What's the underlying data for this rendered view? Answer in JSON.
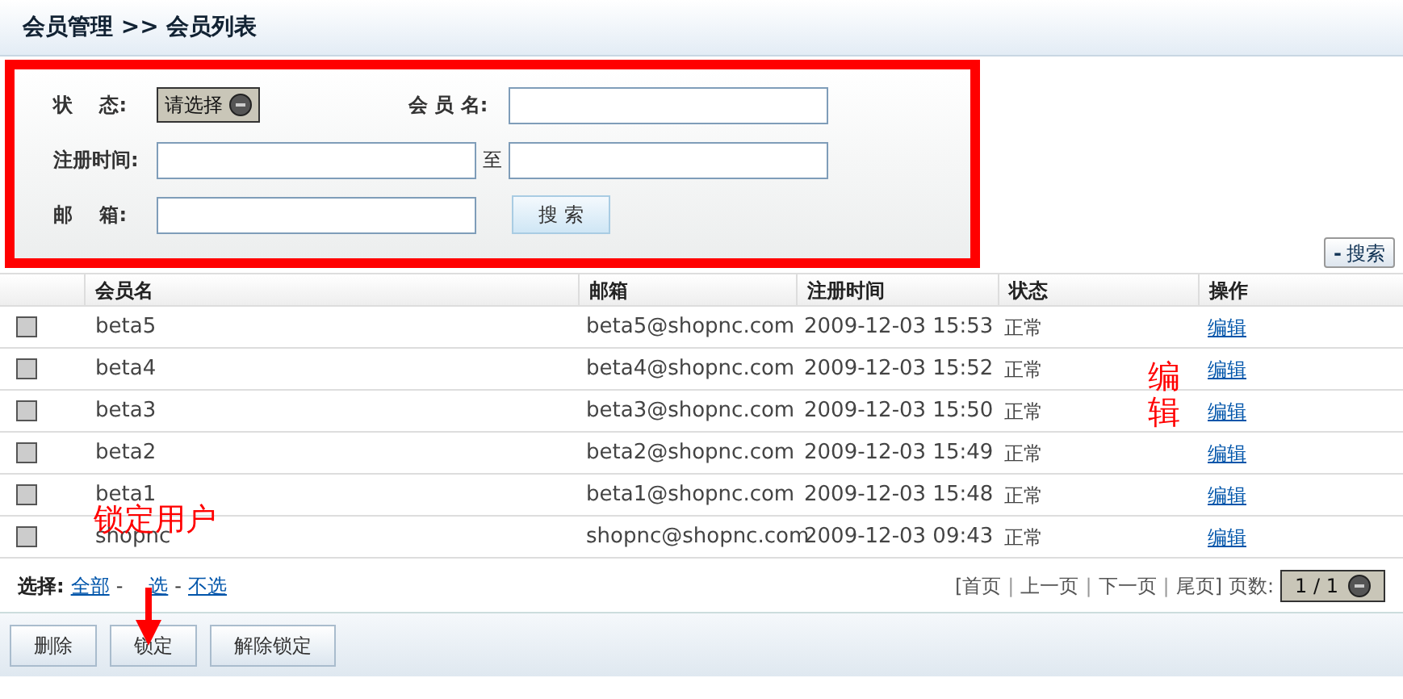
{
  "breadcrumb": {
    "section": "会员管理",
    "separator": ">>",
    "page": "会员列表"
  },
  "search_form": {
    "status_label": "状    态:",
    "status_select": "请选择",
    "name_label": "会 员 名:",
    "date_label": "注册时间:",
    "date_to": "至",
    "email_label": "邮    箱:",
    "search_button": "搜 索"
  },
  "toggle_search_button": {
    "icon": "-",
    "label": "搜索"
  },
  "table": {
    "columns": [
      "会员名",
      "邮箱",
      "注册时间",
      "状态",
      "操作"
    ],
    "rows": [
      {
        "checked": false,
        "name": "beta5",
        "email": "beta5@shopnc.com",
        "registered": "2009-12-03 15:53",
        "status": "正常",
        "action": "编辑"
      },
      {
        "checked": false,
        "name": "beta4",
        "email": "beta4@shopnc.com",
        "registered": "2009-12-03 15:52",
        "status": "正常",
        "action": "编辑"
      },
      {
        "checked": false,
        "name": "beta3",
        "email": "beta3@shopnc.com",
        "registered": "2009-12-03 15:50",
        "status": "正常",
        "action": "编辑"
      },
      {
        "checked": false,
        "name": "beta2",
        "email": "beta2@shopnc.com",
        "registered": "2009-12-03 15:49",
        "status": "正常",
        "action": "编辑"
      },
      {
        "checked": false,
        "name": "beta1",
        "email": "beta1@shopnc.com",
        "registered": "2009-12-03 15:48",
        "status": "正常",
        "action": "编辑"
      },
      {
        "checked": false,
        "name": "shopnc",
        "email": "shopnc@shopnc.com",
        "registered": "2009-12-03 09:43",
        "status": "正常",
        "action": "编辑"
      }
    ]
  },
  "selection": {
    "label": "选择:",
    "links": [
      "全部",
      "选",
      "不选"
    ],
    "separator": "-"
  },
  "pagination": {
    "links": [
      "[首页",
      "上一页",
      "下一页",
      "尾页]"
    ],
    "separator": "|",
    "page_label": "页数:",
    "page_select": "1 / 1"
  },
  "actions": [
    "删除",
    "锁定",
    "解除锁定"
  ],
  "annotations": {
    "edit_note": "编辑",
    "lock_note": "锁定用户"
  }
}
